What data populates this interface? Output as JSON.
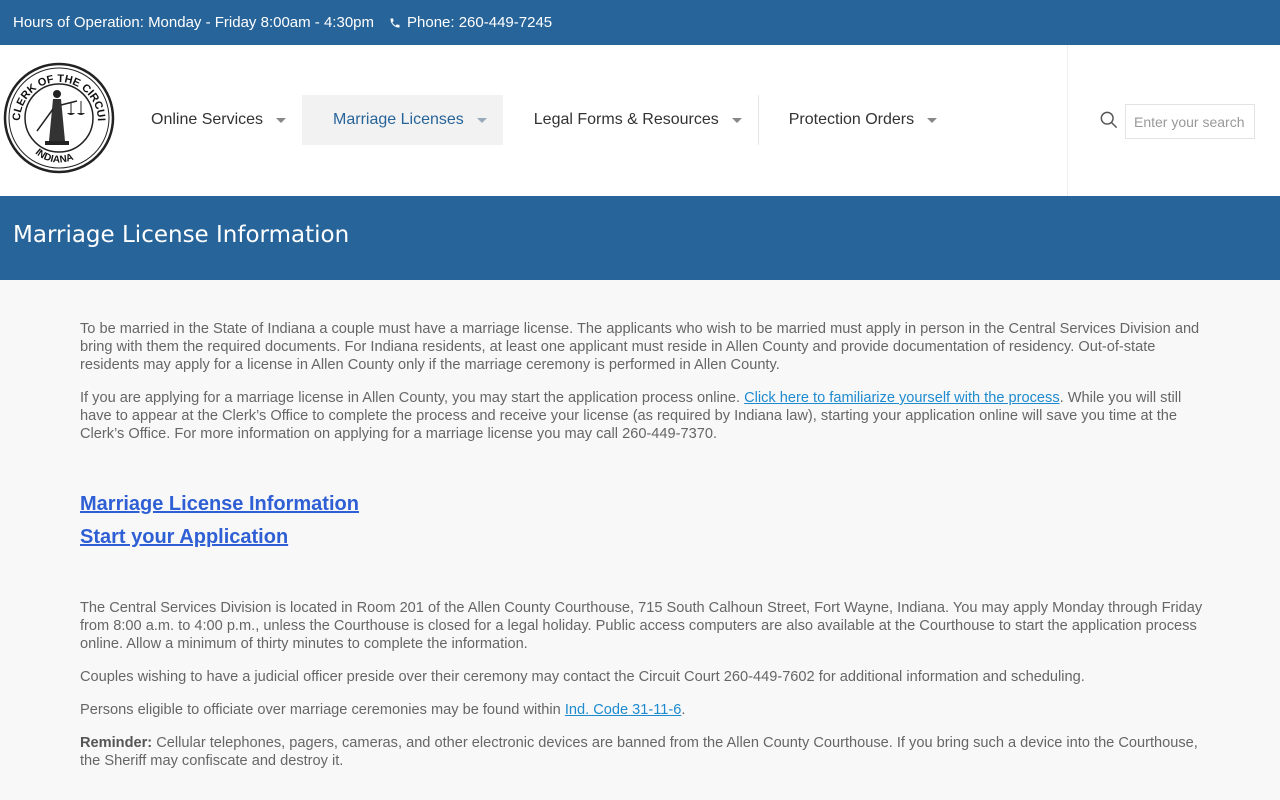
{
  "topbar": {
    "hours": "Hours of Operation: Monday - Friday 8:00am - 4:30pm",
    "phone": "Phone: 260-449-7245"
  },
  "logo": {
    "top_text": "CLERK OF THE CIRCUIT COURT",
    "bottom_text": "INDIANA"
  },
  "nav": {
    "items": [
      {
        "label": "Online Services"
      },
      {
        "label": "Marriage Licenses"
      },
      {
        "label": "Legal Forms & Resources"
      },
      {
        "label": "Protection Orders"
      }
    ]
  },
  "search": {
    "placeholder": "Enter your search"
  },
  "page": {
    "title": "Marriage License Information",
    "p1": "To be married in the State of Indiana a couple must have a marriage license. The applicants who wish to be married must apply in person in the Central Services Division and bring with them the required documents.  For Indiana residents, at least one applicant must reside in Allen County and provide documentation of residency. Out-of-state residents may apply for a license in Allen County only if the marriage ceremony is performed in Allen County.",
    "p2_before": "If you are applying for a marriage license in Allen County, you may start the application process online. ",
    "p2_link": "Click here to familiarize yourself with the process",
    "p2_after": ".  While you will still have to appear at the Clerk’s Office to complete the process and receive your license (as required by Indiana law), starting your application online will save you time at the Clerk’s Office.  For more information on applying for a marriage license you may call 260-449-7370.",
    "link_info": "Marriage License Information",
    "link_start": "Start your Application",
    "p3": "The Central Services Division is located in Room 201 of the Allen County Courthouse, 715 South Calhoun Street, Fort Wayne, Indiana. You may apply Monday through Friday from 8:00 a.m. to 4:00 p.m., unless the Courthouse is closed for a legal holiday. Public access computers are also available at the Courthouse to start the application process online. Allow a minimum of thirty minutes to complete the information.",
    "p4": "Couples wishing to have a judicial officer preside over their ceremony may contact the Circuit Court 260-449-7602 for additional information and scheduling.",
    "p5_before": "Persons eligible to officiate over marriage ceremonies may be found within ",
    "p5_link": "Ind. Code 31-11-6",
    "p5_after": ".",
    "p6_label": "Reminder:",
    "p6_text": " Cellular telephones, pagers, cameras, and other electronic devices are banned from the Allen County Courthouse.  If you bring such a device into the Courthouse, the Sheriff may confiscate and destroy it."
  }
}
